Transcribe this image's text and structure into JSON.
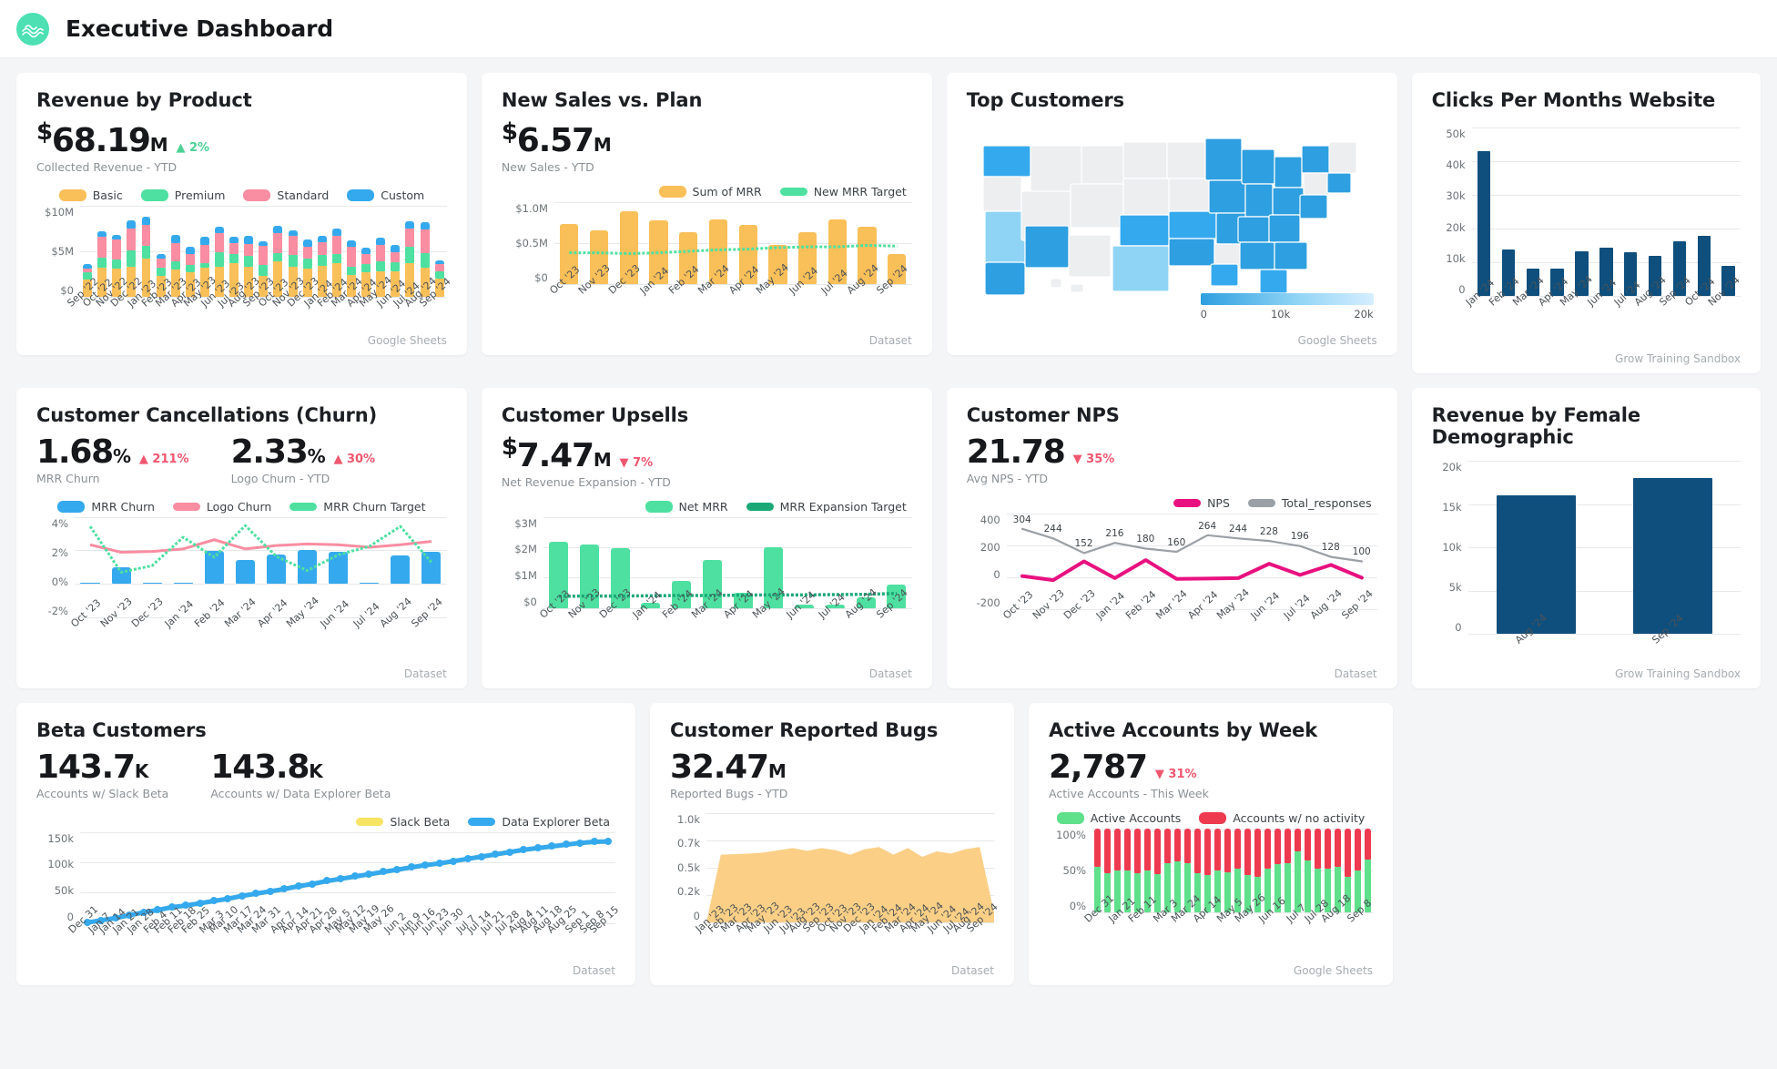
{
  "header": {
    "title": "Executive Dashboard",
    "logo_icon": "wave-circle-logo"
  },
  "theme": {
    "basic": "#f9bf58",
    "premium": "#4ee0a0",
    "standard": "#f98da1",
    "custom": "#35a9ee",
    "green": "#4ad295",
    "red": "#f0566e",
    "pink": "#e8117f",
    "gray": "#9aa0a6",
    "navy": "#0e4f7d",
    "yellow": "#f7e463",
    "bg": "#f4f5f6"
  },
  "cards": {
    "revenue_by_product": {
      "title": "Revenue by Product",
      "kpi": {
        "currency": "$",
        "number": "68.19",
        "unit": "M",
        "delta": "▲ 2%",
        "label": "Collected Revenue - YTD"
      },
      "source": "Google Sheets"
    },
    "new_sales": {
      "title": "New Sales vs. Plan",
      "kpi": {
        "currency": "$",
        "number": "6.57",
        "unit": "M",
        "label": "New Sales - YTD"
      },
      "source": "Dataset"
    },
    "top_customers": {
      "title": "Top Customers",
      "source": "Google Sheets",
      "legend_ticks": [
        "0",
        "10k",
        "20k"
      ]
    },
    "clicks": {
      "title": "Clicks Per Months Website",
      "source": "Grow Training Sandbox"
    },
    "churn": {
      "title": "Customer Cancellations (Churn)",
      "kpi1": {
        "number": "1.68",
        "unit": "%",
        "delta": "▲ 211%",
        "label": "MRR Churn"
      },
      "kpi2": {
        "number": "2.33",
        "unit": "%",
        "delta": "▲ 30%",
        "label": "Logo Churn - YTD"
      },
      "source": "Dataset"
    },
    "upsells": {
      "title": "Customer Upsells",
      "kpi": {
        "currency": "$",
        "number": "7.47",
        "unit": "M",
        "delta": "▼ 7%",
        "label": "Net Revenue Expansion - YTD"
      },
      "source": "Dataset"
    },
    "nps": {
      "title": "Customer NPS",
      "kpi": {
        "number": "21.78",
        "delta": "▼ 35%",
        "label": "Avg NPS - YTD"
      },
      "source": "Dataset"
    },
    "female_demo": {
      "title": "Revenue by Female Demographic",
      "source": "Grow Training Sandbox"
    },
    "beta": {
      "title": "Beta Customers",
      "kpi1": {
        "number": "143.7",
        "unit": "K",
        "label": "Accounts w/ Slack Beta"
      },
      "kpi2": {
        "number": "143.8",
        "unit": "K",
        "label": "Accounts w/ Data Explorer Beta"
      },
      "source": "Dataset"
    },
    "bugs": {
      "title": "Customer Reported Bugs",
      "kpi": {
        "number": "32.47",
        "unit": "M",
        "label": "Reported Bugs - YTD"
      },
      "source": "Dataset"
    },
    "active_accounts": {
      "title": "Active Accounts by Week",
      "kpi": {
        "number": "2,787",
        "delta": "▼ 31%",
        "label": "Active Accounts - This Week"
      },
      "source": "Google Sheets"
    }
  },
  "chart_data": [
    {
      "id": "revenue_by_product",
      "type": "bar",
      "stacked": true,
      "title": "Revenue by Product",
      "ylabel": "",
      "xlabel": "",
      "ylim": [
        0,
        11
      ],
      "yticks": [
        "$10M",
        "$5M",
        "$0"
      ],
      "grid": true,
      "legend": "top",
      "categories": [
        "Sep '22",
        "Oct '22",
        "Nov '22",
        "Dec '22",
        "Jan '23",
        "Feb '23",
        "Mar '23",
        "Apr '23",
        "May '23",
        "Jun '23",
        "Jul '23",
        "Aug '23",
        "Sep '23",
        "Oct '23",
        "Nov '23",
        "Dec '23",
        "Jan '24",
        "Feb '24",
        "Mar '24",
        "Apr '24",
        "May '24",
        "Jun '24",
        "Jul '24",
        "Aug '24",
        "Sep '24"
      ],
      "series": [
        {
          "name": "Basic",
          "color": "#f9bf58",
          "values": [
            2.1,
            3.5,
            3.4,
            3.6,
            4.6,
            2.5,
            3.3,
            3.0,
            3.5,
            3.6,
            4.1,
            3.6,
            2.5,
            4.3,
            3.6,
            3.4,
            3.7,
            4.1,
            2.6,
            2.9,
            3.1,
            3.1,
            4.1,
            3.5,
            2.2
          ]
        },
        {
          "name": "Premium",
          "color": "#4ee0a0",
          "values": [
            0.8,
            1.2,
            1.1,
            2.0,
            1.5,
            1.0,
            1.0,
            0.8,
            0.6,
            1.8,
            1.0,
            1.3,
            1.3,
            1.0,
            1.4,
            1.2,
            1.3,
            1.0,
            1.0,
            1.0,
            1.2,
            1.1,
            1.9,
            1.8,
            0.9
          ]
        },
        {
          "name": "Standard",
          "color": "#f98da1",
          "values": [
            0.5,
            2.5,
            2.4,
            2.6,
            2.6,
            1.1,
            2.2,
            1.3,
            2.2,
            2.3,
            1.4,
            1.5,
            2.3,
            2.4,
            2.3,
            1.4,
            1.6,
            2.2,
            2.4,
            1.3,
            2.0,
            1.2,
            2.2,
            2.8,
            0.8
          ]
        },
        {
          "name": "Custom",
          "color": "#35a9ee",
          "values": [
            0.5,
            0.7,
            0.6,
            1.0,
            1.0,
            0.6,
            1.0,
            0.9,
            0.9,
            0.8,
            0.7,
            0.9,
            0.6,
            0.9,
            0.7,
            0.9,
            0.8,
            0.9,
            0.8,
            0.7,
            0.8,
            0.8,
            0.9,
            0.9,
            0.5
          ]
        }
      ]
    },
    {
      "id": "new_sales",
      "type": "bar",
      "title": "New Sales vs. Plan",
      "ylim": [
        0,
        1.1
      ],
      "yticks": [
        "$1.0M",
        "$0.5M",
        "$0"
      ],
      "grid": true,
      "legend": "top-right",
      "categories": [
        "Oct '23",
        "Nov '23",
        "Dec '23",
        "Jan '24",
        "Feb '24",
        "Mar '24",
        "Apr '24",
        "May '24",
        "Jun '24",
        "Jul '24",
        "Aug '24",
        "Sep '24"
      ],
      "series": [
        {
          "name": "Sum of MRR",
          "color": "#f9bf58",
          "type": "bar",
          "values": [
            0.81,
            0.72,
            0.98,
            0.85,
            0.69,
            0.86,
            0.79,
            0.52,
            0.7,
            0.87,
            0.77,
            0.4
          ]
        },
        {
          "name": "New MRR Target",
          "color": "#4ee0a0",
          "type": "dotted-line",
          "values": [
            0.42,
            0.42,
            0.41,
            0.42,
            0.44,
            0.46,
            0.47,
            0.49,
            0.5,
            0.5,
            0.52,
            0.51
          ]
        }
      ]
    },
    {
      "id": "top_customers",
      "type": "heatmap",
      "subtype": "choropleth-map-usa",
      "title": "Top Customers",
      "legend": "bottom-right",
      "scale_ticks": [
        0,
        10000,
        20000
      ],
      "scale_labels": [
        "0",
        "10k",
        "20k"
      ],
      "scale_colors": [
        "#2e9fe0",
        "#8fd4f5",
        "#cfeaff"
      ]
    },
    {
      "id": "clicks",
      "type": "bar",
      "title": "Clicks Per Months Website",
      "ylim": [
        0,
        50000
      ],
      "yticks": [
        "50k",
        "40k",
        "30k",
        "20k",
        "10k",
        "0"
      ],
      "grid": true,
      "categories": [
        "Jan '24",
        "Feb '24",
        "Mar '24",
        "Apr '24",
        "May '24",
        "Jun '24",
        "Jul '24",
        "Aug '24",
        "Sep '24",
        "Oct '24",
        "Nov '24"
      ],
      "values": [
        43000,
        13800,
        8000,
        8000,
        13300,
        14300,
        13000,
        12000,
        16200,
        17800,
        8800
      ],
      "color": "#0e4f7d"
    },
    {
      "id": "churn",
      "type": "bar",
      "title": "Customer Cancellations (Churn)",
      "ylim": [
        -2,
        4
      ],
      "yticks": [
        "4%",
        "2%",
        "0%",
        "-2%"
      ],
      "grid": true,
      "legend": "top",
      "categories": [
        "Oct '23",
        "Nov '23",
        "Dec '23",
        "Jan '24",
        "Feb '24",
        "Mar '24",
        "Apr '24",
        "May '24",
        "Jun '24",
        "Jul '24",
        "Aug '24",
        "Sep '24"
      ],
      "series": [
        {
          "name": "MRR Churn",
          "color": "#35a9ee",
          "type": "bar",
          "values": [
            0.05,
            1.0,
            0.05,
            0.0,
            1.95,
            1.45,
            1.75,
            2.05,
            1.9,
            0.05,
            1.7,
            1.9
          ]
        },
        {
          "name": "Logo Churn",
          "color": "#f98da1",
          "type": "line",
          "values": [
            2.35,
            1.9,
            1.95,
            2.1,
            2.65,
            2.1,
            2.3,
            2.4,
            2.35,
            2.2,
            2.35,
            2.55
          ]
        },
        {
          "name": "MRR Churn Target",
          "color": "#4ee0a0",
          "type": "dotted-line",
          "values": [
            3.45,
            0.7,
            1.1,
            2.8,
            1.6,
            3.5,
            1.65,
            0.8,
            1.75,
            2.25,
            3.45,
            1.3
          ]
        }
      ]
    },
    {
      "id": "upsells",
      "type": "bar",
      "title": "Customer Upsells",
      "ylim": [
        0,
        3.2
      ],
      "yticks": [
        "$3M",
        "$2M",
        "$1M",
        "$0"
      ],
      "grid": true,
      "legend": "top-right",
      "categories": [
        "Oct '23",
        "Nov '23",
        "Dec '23",
        "Jan '24",
        "Feb '24",
        "Mar '24",
        "Apr '24",
        "May '24",
        "Jun '24",
        "Jul '24",
        "Aug '24",
        "Sep '24"
      ],
      "series": [
        {
          "name": "Net MRR",
          "color": "#4ee0a0",
          "type": "bar",
          "values": [
            2.32,
            2.22,
            2.12,
            0.18,
            0.95,
            1.68,
            0.55,
            2.15,
            0.12,
            0.13,
            0.38,
            0.82
          ]
        },
        {
          "name": "MRR Expansion Target",
          "color": "#1aa877",
          "type": "dotted-line",
          "values": [
            0.42,
            0.43,
            0.43,
            0.44,
            0.45,
            0.45,
            0.46,
            0.47,
            0.47,
            0.48,
            0.49,
            0.52
          ]
        }
      ]
    },
    {
      "id": "nps",
      "type": "line",
      "title": "Customer NPS",
      "ylim": [
        -200,
        400
      ],
      "yticks": [
        "400",
        "200",
        "0",
        "-200"
      ],
      "grid": true,
      "legend": "top-right",
      "categories": [
        "Oct '23",
        "Nov '23",
        "Dec '23",
        "Jan '24",
        "Feb '24",
        "Mar '24",
        "Apr '24",
        "May '24",
        "Jun '24",
        "Jul '24",
        "Aug '24",
        "Sep '24"
      ],
      "series": [
        {
          "name": "NPS",
          "color": "#e8117f",
          "values": [
            8,
            -18,
            100,
            -5,
            108,
            -10,
            -8,
            -5,
            85,
            15,
            78,
            -3
          ]
        },
        {
          "name": "Total_responses",
          "color": "#9aa0a6",
          "labels": [
            "304",
            "244",
            "152",
            "216",
            "180",
            "160",
            "264",
            "244",
            "228",
            "196",
            "128",
            "100"
          ],
          "values": [
            304,
            244,
            152,
            216,
            180,
            160,
            264,
            244,
            228,
            196,
            128,
            100
          ]
        }
      ]
    },
    {
      "id": "female_demo",
      "type": "bar",
      "title": "Revenue by Female Demographic",
      "ylim": [
        0,
        20000
      ],
      "yticks": [
        "20k",
        "15k",
        "10k",
        "5k",
        "0"
      ],
      "grid": true,
      "categories": [
        "Aug '24",
        "Sep '24"
      ],
      "values": [
        16000,
        18000
      ],
      "color": "#0e4f7d"
    },
    {
      "id": "beta",
      "type": "line",
      "title": "Beta Customers",
      "ylim": [
        0,
        160000
      ],
      "yticks": [
        "150k",
        "100k",
        "50k",
        "0"
      ],
      "grid": true,
      "legend": "top-right",
      "categories": [
        "Dec 31",
        "Jan 7",
        "Jan 14",
        "Jan 21",
        "Jan 28",
        "Feb 4",
        "Feb 11",
        "Feb 18",
        "Feb 25",
        "Mar 3",
        "Mar 10",
        "Mar 17",
        "Mar 24",
        "Mar 31",
        "Apr 7",
        "Apr 14",
        "Apr 21",
        "Apr 28",
        "May 5",
        "May 12",
        "May 19",
        "May 26",
        "Jun 2",
        "Jun 9",
        "Jun 16",
        "Jun 23",
        "Jun 30",
        "Jul 7",
        "Jul 14",
        "Jul 21",
        "Jul 28",
        "Aug 4",
        "Aug 11",
        "Aug 18",
        "Aug 25",
        "Sep 1",
        "Sep 8",
        "Sep 15"
      ],
      "series": [
        {
          "name": "Slack Beta",
          "color": "#f7e463",
          "values": [
            1000,
            5000,
            9000,
            14000,
            19000,
            23000,
            28000,
            31000,
            35000,
            39000,
            43000,
            48000,
            52000,
            56000,
            60000,
            65000,
            69000,
            74000,
            78000,
            82000,
            86000,
            90000,
            94000,
            98000,
            102000,
            105000,
            109000,
            113000,
            117000,
            121000,
            125000,
            129000,
            132000,
            135000,
            138000,
            141000,
            143000,
            143700
          ]
        },
        {
          "name": "Data Explorer Beta",
          "color": "#35a9ee",
          "values": [
            1200,
            5200,
            9200,
            14200,
            19200,
            23200,
            28200,
            31200,
            35200,
            39200,
            43200,
            48200,
            52200,
            56200,
            60200,
            65200,
            69200,
            74200,
            78200,
            82200,
            86200,
            90200,
            94200,
            98200,
            102200,
            105200,
            109200,
            113200,
            117200,
            121200,
            125200,
            129200,
            132200,
            135200,
            138200,
            141200,
            143200,
            143800
          ]
        }
      ]
    },
    {
      "id": "bugs",
      "type": "area",
      "title": "Customer Reported Bugs",
      "ylim": [
        0,
        1000
      ],
      "yticks": [
        "1.0k",
        "0.7k",
        "0.5k",
        "0.2k",
        "0"
      ],
      "grid": true,
      "categories": [
        "Jan '23",
        "Feb '23",
        "Mar '23",
        "Apr '23",
        "May '23",
        "Jun '23",
        "Jul '23",
        "Aug '23",
        "Sep '23",
        "Oct '23",
        "Nov '23",
        "Dec '23",
        "Jan '24",
        "Feb '24",
        "Mar '24",
        "Apr '24",
        "May '24",
        "Jun '24",
        "Jul '24",
        "Aug '24",
        "Sep '24"
      ],
      "values": [
        0,
        620,
        625,
        630,
        640,
        660,
        680,
        655,
        680,
        660,
        620,
        670,
        690,
        620,
        680,
        600,
        650,
        630,
        670,
        690,
        90
      ],
      "color": "#fbcf86"
    },
    {
      "id": "active_accounts",
      "type": "bar",
      "stacked": true,
      "normalized": true,
      "title": "Active Accounts by Week",
      "ylim": [
        0,
        100
      ],
      "yticks": [
        "100%",
        "50%",
        "0%"
      ],
      "grid": true,
      "legend": "top",
      "categories": [
        "Dec 31",
        "Jan 21",
        "Feb 11",
        "Mar 3",
        "Mar 24",
        "Apr 14",
        "May 5",
        "May 26",
        "Jun 16",
        "Jul 7",
        "Jul 28",
        "Aug 18",
        "Sep 8"
      ],
      "series": [
        {
          "name": "Active Accounts",
          "color": "#5fe08b",
          "values": [
            54,
            47,
            50,
            50,
            47,
            50,
            45,
            58,
            61,
            58,
            47,
            44,
            50,
            48,
            52,
            44,
            42,
            52,
            57,
            58,
            73,
            62,
            52,
            52,
            54,
            42,
            50,
            63
          ]
        },
        {
          "name": "Accounts w/ no activity",
          "color": "#ee3a4f",
          "values": [
            46,
            53,
            50,
            50,
            53,
            50,
            55,
            42,
            39,
            42,
            53,
            56,
            50,
            52,
            48,
            56,
            58,
            48,
            43,
            42,
            27,
            38,
            48,
            48,
            46,
            58,
            50,
            37
          ]
        }
      ]
    }
  ]
}
